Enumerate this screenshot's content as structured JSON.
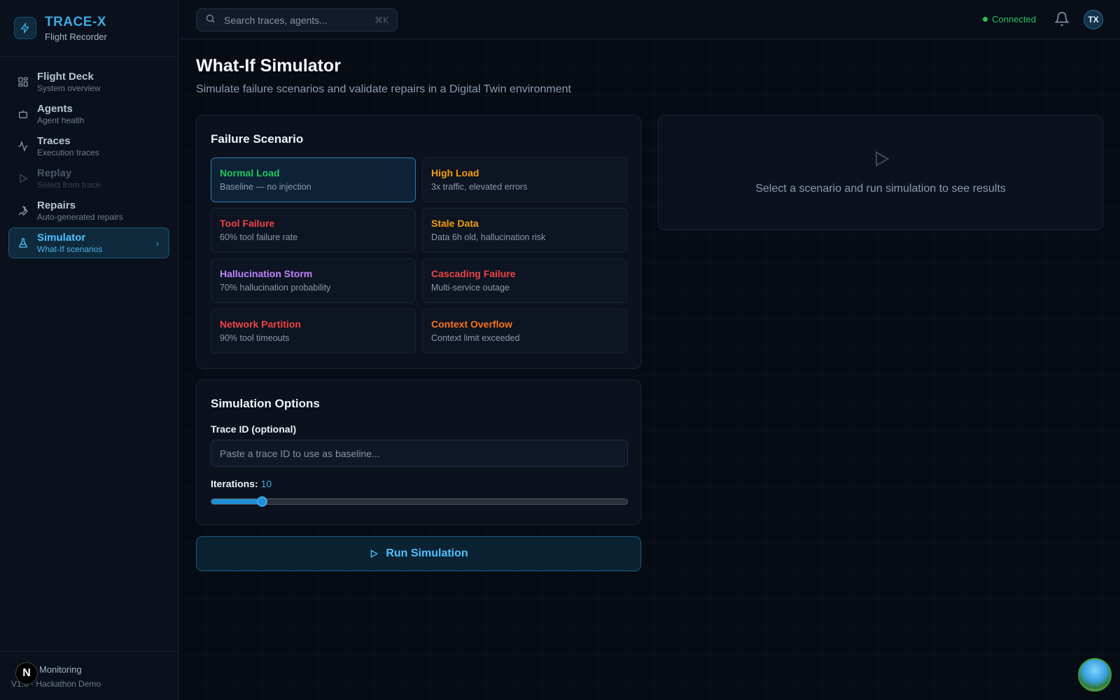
{
  "brand": {
    "title": "TRACE-X",
    "subtitle": "Flight Recorder",
    "icon": "lightning-icon"
  },
  "sidebar": {
    "items": [
      {
        "label": "Flight Deck",
        "desc": "System overview",
        "icon": "grid-icon",
        "state": "normal"
      },
      {
        "label": "Agents",
        "desc": "Agent health",
        "icon": "bot-icon",
        "state": "normal"
      },
      {
        "label": "Traces",
        "desc": "Execution traces",
        "icon": "activity-icon",
        "state": "normal"
      },
      {
        "label": "Replay",
        "desc": "Select from trace",
        "icon": "play-icon",
        "state": "disabled"
      },
      {
        "label": "Repairs",
        "desc": "Auto-generated repairs",
        "icon": "wrench-icon",
        "state": "normal"
      },
      {
        "label": "Simulator",
        "desc": "What-If scenarios",
        "icon": "flask-icon",
        "state": "active"
      }
    ],
    "footer": {
      "status": "Monitoring",
      "version": "V1.0 · Hackathon Demo",
      "badge": "N"
    }
  },
  "topbar": {
    "search_placeholder": "Search traces, agents...",
    "search_shortcut": "⌘K",
    "connection": "Connected",
    "avatar_initials": "TX"
  },
  "page": {
    "title": "What-If Simulator",
    "subtitle": "Simulate failure scenarios and validate repairs in a Digital Twin environment"
  },
  "scenario_card": {
    "title": "Failure Scenario",
    "scenarios": [
      {
        "name": "Normal Load",
        "desc": "Baseline — no injection",
        "color": "#22c55e",
        "selected": true
      },
      {
        "name": "High Load",
        "desc": "3x traffic, elevated errors",
        "color": "#f59e0b",
        "selected": false
      },
      {
        "name": "Tool Failure",
        "desc": "60% tool failure rate",
        "color": "#ef4444",
        "selected": false
      },
      {
        "name": "Stale Data",
        "desc": "Data 6h old, hallucination risk",
        "color": "#f59e0b",
        "selected": false
      },
      {
        "name": "Hallucination Storm",
        "desc": "70% hallucination probability",
        "color": "#c084fc",
        "selected": false
      },
      {
        "name": "Cascading Failure",
        "desc": "Multi-service outage",
        "color": "#ef4444",
        "selected": false
      },
      {
        "name": "Network Partition",
        "desc": "90% tool timeouts",
        "color": "#ef4444",
        "selected": false
      },
      {
        "name": "Context Overflow",
        "desc": "Context limit exceeded",
        "color": "#f97316",
        "selected": false
      }
    ]
  },
  "options_card": {
    "title": "Simulation Options",
    "trace_label": "Trace ID (optional)",
    "trace_value": "",
    "trace_placeholder": "Paste a trace ID to use as baseline...",
    "iterations_label": "Iterations:",
    "iterations_value": "10",
    "slider_fraction": 0.121
  },
  "run_button": {
    "label": "Run Simulation"
  },
  "results": {
    "empty_text": "Select a scenario and run simulation to see results"
  },
  "colors": {
    "accent": "#3fa9e0",
    "success": "#22c55e",
    "background": "#070b14"
  }
}
